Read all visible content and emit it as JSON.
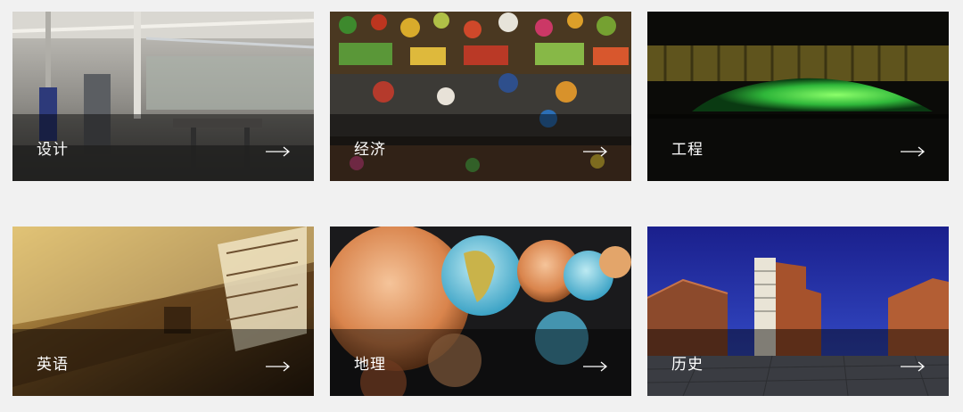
{
  "cards": [
    {
      "label": "设计"
    },
    {
      "label": "经济"
    },
    {
      "label": "工程"
    },
    {
      "label": "英语"
    },
    {
      "label": "地理"
    },
    {
      "label": "历史"
    }
  ]
}
